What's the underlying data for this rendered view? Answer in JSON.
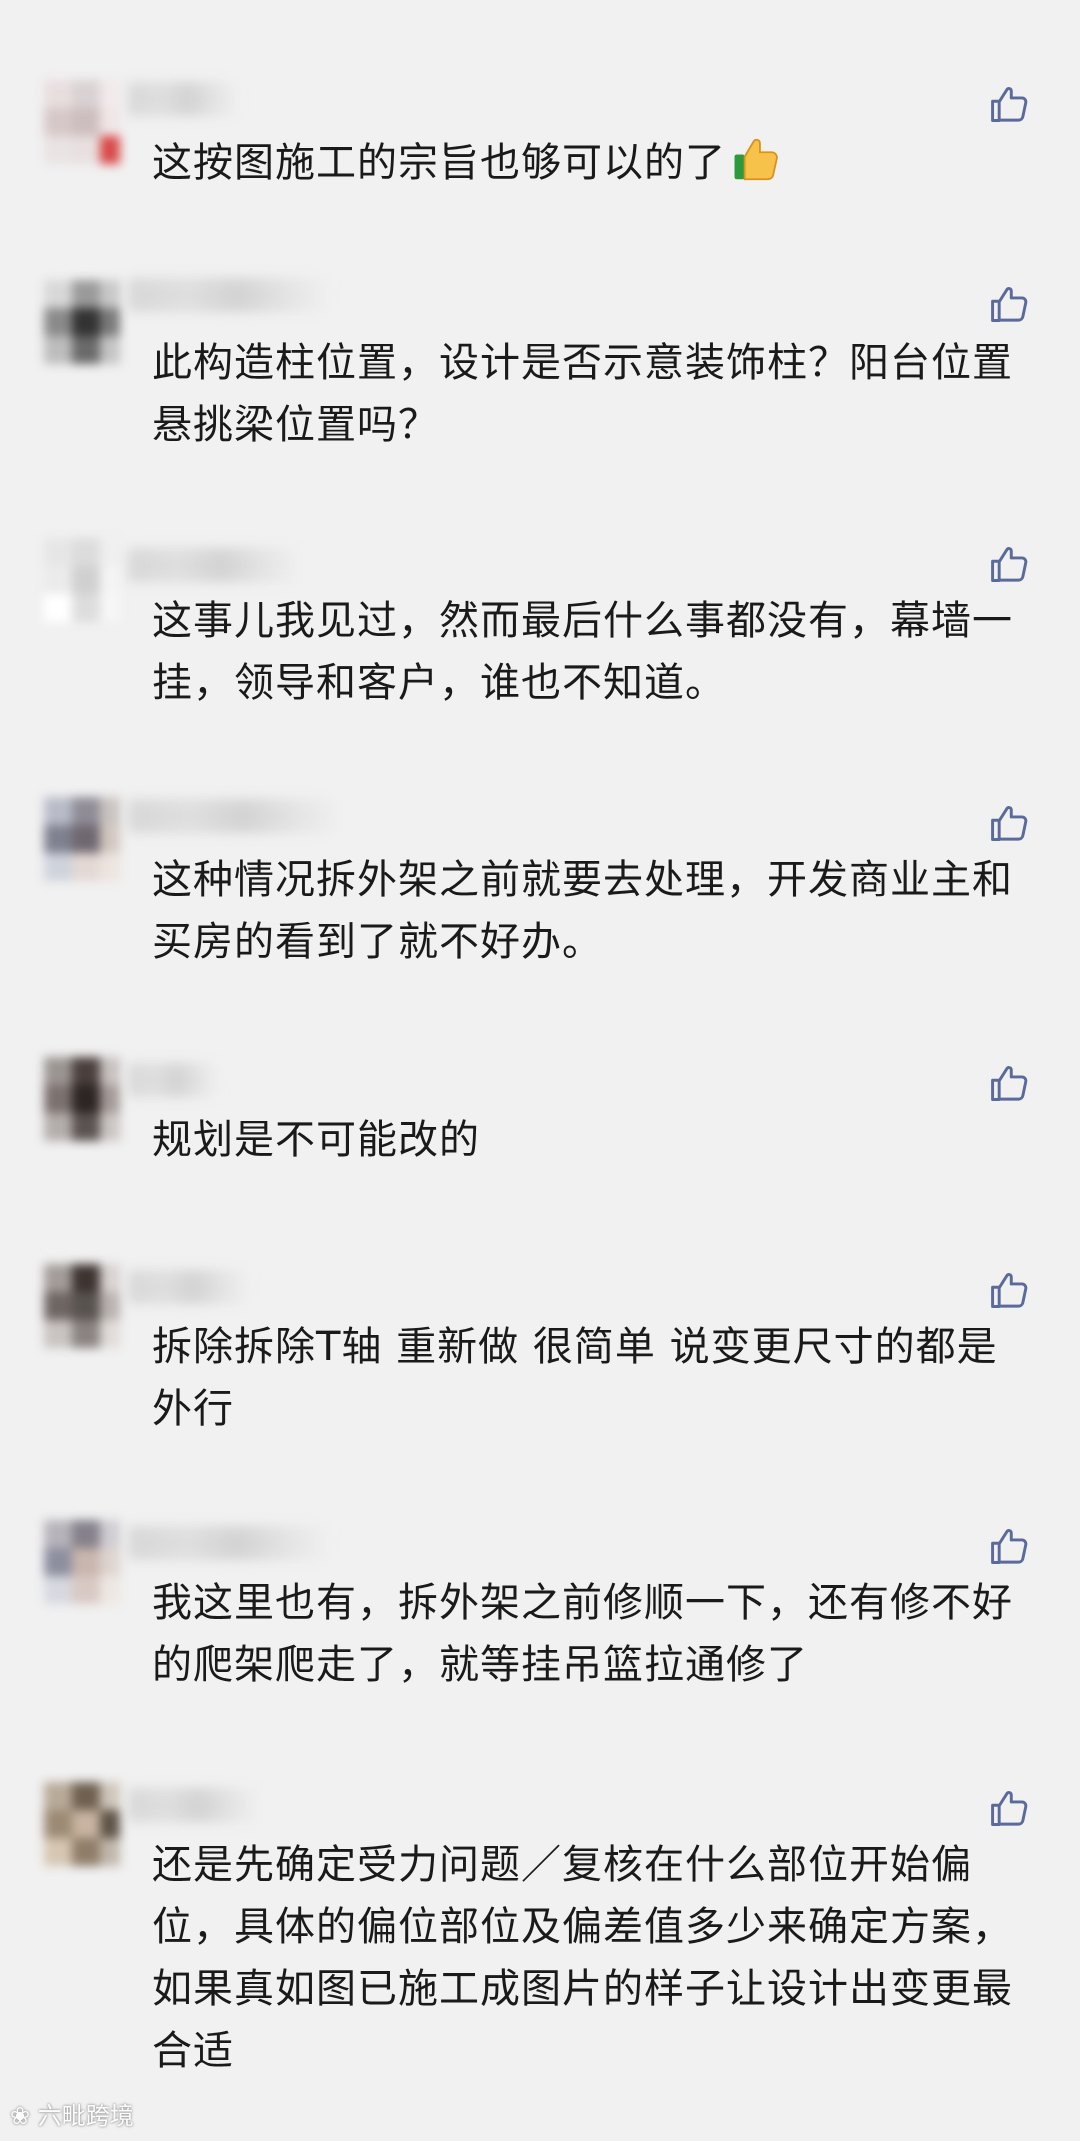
{
  "comments": [
    {
      "text": "这按图施工的宗旨也够可以的了",
      "emoji": "thumbs-up-emoji"
    },
    {
      "text": "此构造柱位置，设计是否示意装饰柱？阳台位置悬挑梁位置吗？"
    },
    {
      "text": "这事儿我见过，然而最后什么事都没有，幕墙一挂，领导和客户，谁也不知道。"
    },
    {
      "text": "这种情况拆外架之前就要去处理，开发商业主和买房的看到了就不好办。"
    },
    {
      "text": "规划是不可能改的"
    },
    {
      "text": "拆除拆除T轴 重新做 很简单 说变更尺寸的都是外行"
    },
    {
      "text": "我这里也有，拆外架之前修顺一下，还有修不好的爬架爬走了，就等挂吊篮拉通修了"
    },
    {
      "text": "还是先确定受力问题／复核在什么部位开始偏位，具体的偏位部位及偏差值多少来确定方案，如果真如图已施工成图片的样子让设计出变更最合适"
    }
  ],
  "icons": {
    "like": "thumbs-up-outline-icon",
    "like_color": "#5a6a9a"
  },
  "watermark": "六毗跨境"
}
